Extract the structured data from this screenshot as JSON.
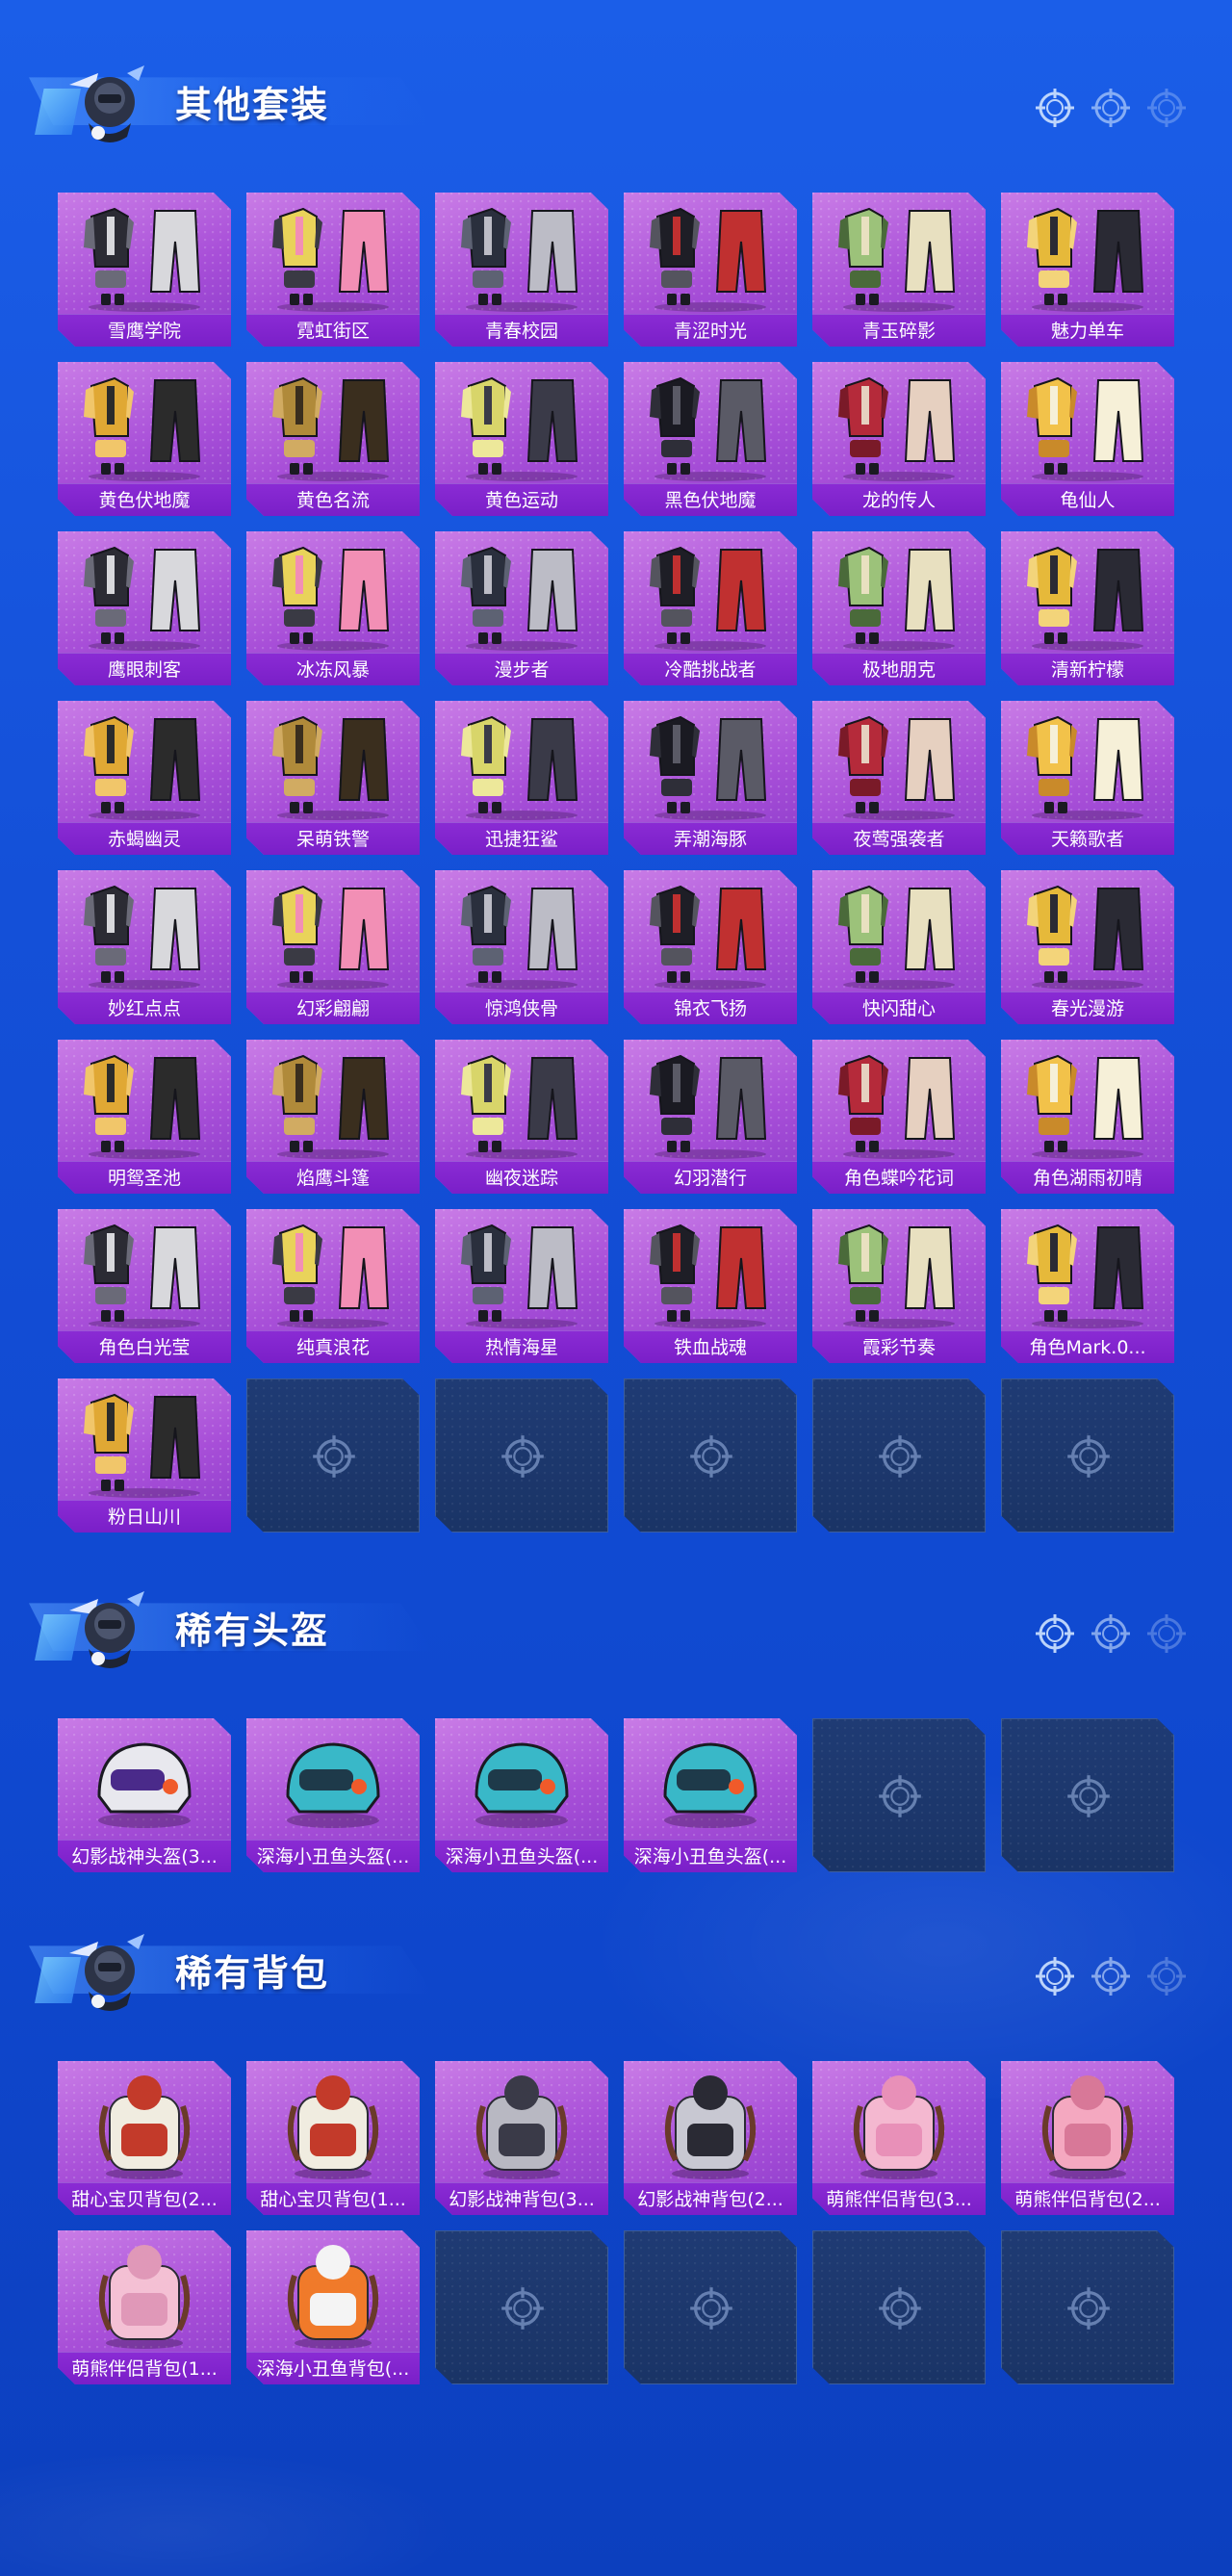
{
  "sections": [
    {
      "title": "其他套装",
      "items": [
        "雪鹰学院",
        "霓虹街区",
        "青春校园",
        "青涩时光",
        "青玉碎影",
        "魅力单车",
        "黄色伏地魔",
        "黄色名流",
        "黄色运动",
        "黑色伏地魔",
        "龙的传人",
        "龟仙人",
        "鹰眼刺客",
        "冰冻风暴",
        "漫步者",
        "冷酷挑战者",
        "极地朋克",
        "清新柠檬",
        "赤蝎幽灵",
        "呆萌铁警",
        "迅捷狂鲨",
        "弄潮海豚",
        "夜莺强袭者",
        "天籁歌者",
        "妙红点点",
        "幻彩翩翩",
        "惊鸿侠骨",
        "锦衣飞扬",
        "快闪甜心",
        "春光漫游",
        "明鸳圣池",
        "焰鹰斗篷",
        "幽夜迷踪",
        "幻羽潜行",
        "角色蝶吟花词",
        "角色湖雨初晴",
        "角色白光莹",
        "纯真浪花",
        "热情海星",
        "铁血战魂",
        "霞彩节奏",
        "角色Mark.0...",
        "粉日山川"
      ],
      "empty_count": 5
    },
    {
      "title": "稀有头盔",
      "items": [
        "幻影战神头盔(3...",
        "深海小丑鱼头盔(...",
        "深海小丑鱼头盔(...",
        "深海小丑鱼头盔(..."
      ],
      "empty_count": 2
    },
    {
      "title": "稀有背包",
      "items": [
        "甜心宝贝背包(2...",
        "甜心宝贝背包(1...",
        "幻影战神背包(3...",
        "幻影战神背包(2...",
        "萌熊伴侣背包(3...",
        "萌熊伴侣背包(2...",
        "萌熊伴侣背包(1...",
        "深海小丑鱼背包(..."
      ],
      "empty_count": 4
    }
  ],
  "colors": {
    "background": "#1552db",
    "tile_filled": "#a84fd8",
    "tile_label": "#7a1fc8",
    "tile_empty": "#1f3b74"
  },
  "icons": [
    "mascot-icon",
    "crosshair-icon",
    "outfit-icon",
    "helmet-icon",
    "backpack-icon"
  ]
}
